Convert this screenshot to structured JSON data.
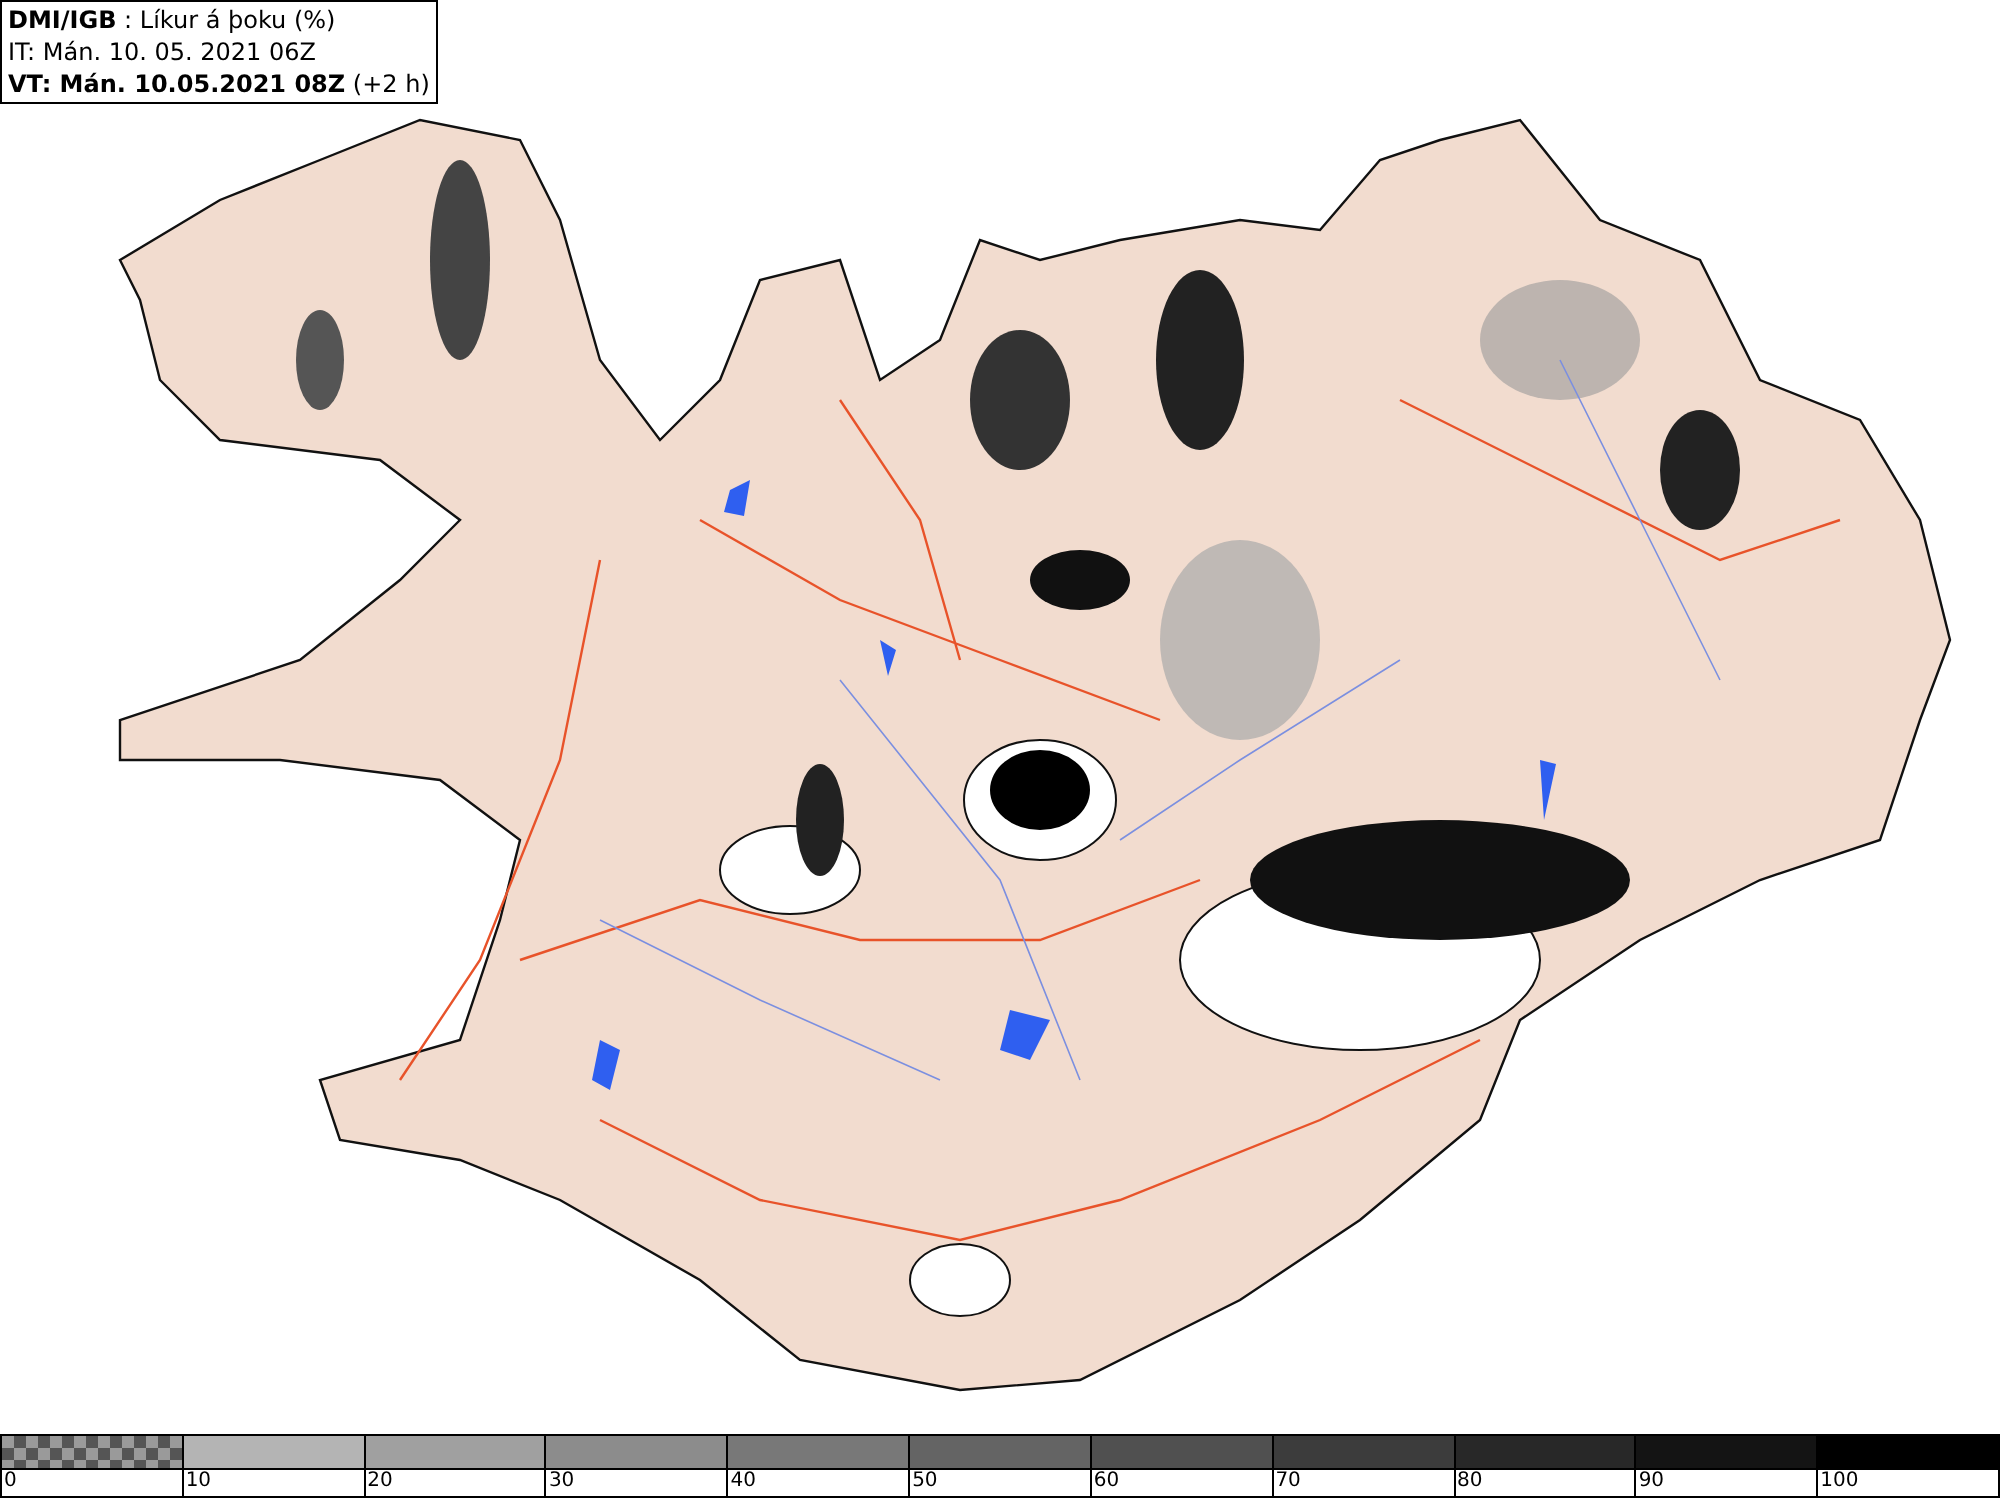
{
  "header": {
    "lines": [
      "**DMI/IGB** : Líkur á þoku (%)",
      "IT: Mán. 10. 05. 2021 06Z",
      "**VT: Mán. 10.05.2021 08Z** (+2 h)"
    ]
  },
  "legend": {
    "bins": [
      {
        "kind": "checker",
        "color": "#9a9a9a"
      },
      {
        "kind": "solid",
        "color": "#b4b4b4"
      },
      {
        "kind": "solid",
        "color": "#a0a0a0"
      },
      {
        "kind": "solid",
        "color": "#8c8c8c"
      },
      {
        "kind": "solid",
        "color": "#787878"
      },
      {
        "kind": "solid",
        "color": "#646464"
      },
      {
        "kind": "solid",
        "color": "#505050"
      },
      {
        "kind": "solid",
        "color": "#3c3c3c"
      },
      {
        "kind": "solid",
        "color": "#282828"
      },
      {
        "kind": "solid",
        "color": "#141414"
      },
      {
        "kind": "solid",
        "color": "#000000"
      }
    ],
    "labels": [
      "0",
      "10",
      "20",
      "30",
      "40",
      "50",
      "60",
      "70",
      "80",
      "90",
      "100"
    ]
  }
}
